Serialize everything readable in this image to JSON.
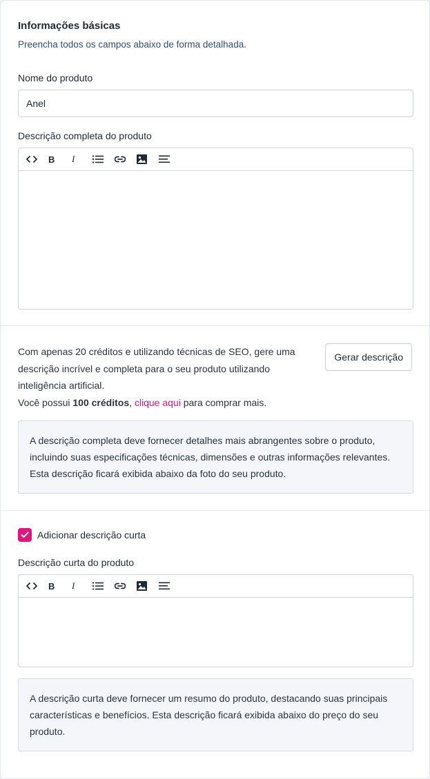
{
  "basic": {
    "title": "Informações básicas",
    "subtitle": "Preencha todos os campos abaixo de forma detalhada.",
    "name_label": "Nome do produto",
    "name_value": "Anel",
    "full_desc_label": "Descrição completa do produto"
  },
  "toolbar": {
    "code_icon": "code-icon",
    "bold_label": "B",
    "italic_label": "I",
    "list_icon": "list-icon",
    "link_icon": "link-icon",
    "image_icon": "image-icon",
    "align_icon": "align-left-icon"
  },
  "ai": {
    "text_line": "Com apenas 20 créditos e utilizando técnicas de SEO, gere uma descrição incrível e completa para o seu produto utilizando inteligência artificial.",
    "credits_prefix": "Você possui ",
    "credits_amount": "100 créditos",
    "credits_comma": ", ",
    "credits_link": "clique aqui",
    "credits_suffix": " para comprar mais.",
    "button_label": "Gerar descrição",
    "info": "A descrição completa deve fornecer detalhes mais abrangentes sobre o produto, incluindo suas especificações técnicas, dimensões e outras informações relevantes. Esta descrição ficará exibida abaixo da foto do seu produto."
  },
  "short": {
    "checkbox_label": "Adicionar descrição curta",
    "checkbox_checked": true,
    "label": "Descrição curta do produto",
    "info": "A descrição curta deve fornecer um resumo do produto, destacando suas principais características e benefícios. Esta descrição ficará exibida abaixo do preço do seu produto."
  },
  "colors": {
    "accent": "#e0167f",
    "info_bg": "#f4f6f9",
    "border": "#d0d5dd"
  }
}
